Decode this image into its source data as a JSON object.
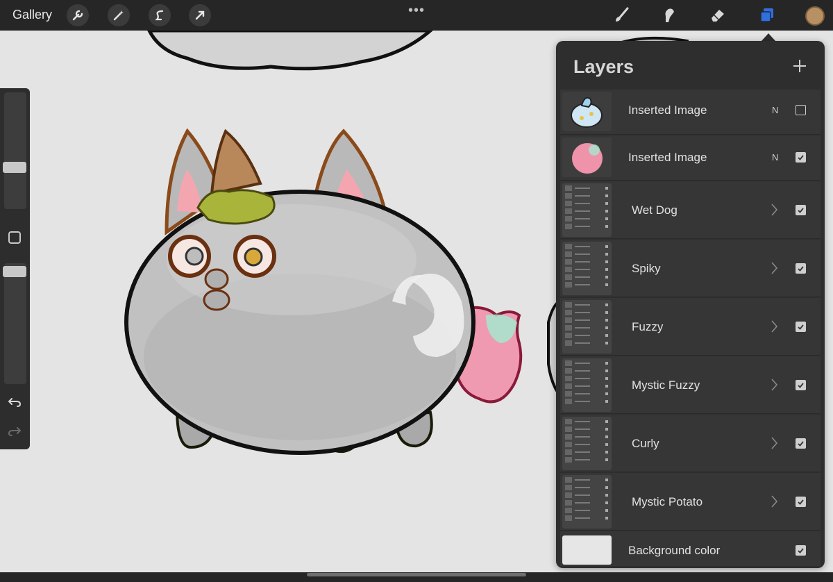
{
  "app": {
    "gallery_label": "Gallery",
    "more_menu": "•••"
  },
  "toolbar": {
    "left_tools": [
      "wrench-icon",
      "magic-wand-icon",
      "selection-icon",
      "transform-arrow-icon"
    ],
    "right_tools": [
      "brush-icon",
      "smudge-icon",
      "eraser-icon",
      "layers-icon"
    ],
    "active_color": "#b79064",
    "layers_accent": "#2f6fe0"
  },
  "sidebar": {
    "brush_size_label": "brush-size-slider",
    "opacity_label": "opacity-slider",
    "undo_icon": "undo-icon",
    "redo_icon": "redo-icon"
  },
  "layers": {
    "title": "Layers",
    "add_icon": "plus-icon",
    "items": [
      {
        "name": "Inserted Image",
        "blend": "N",
        "visible": false,
        "kind": "image"
      },
      {
        "name": "Inserted Image",
        "blend": "N",
        "visible": true,
        "kind": "image"
      },
      {
        "name": "Wet Dog",
        "blend": "",
        "visible": true,
        "kind": "group"
      },
      {
        "name": "Spiky",
        "blend": "",
        "visible": true,
        "kind": "group"
      },
      {
        "name": "Fuzzy",
        "blend": "",
        "visible": true,
        "kind": "group"
      },
      {
        "name": "Mystic Fuzzy",
        "blend": "",
        "visible": true,
        "kind": "group"
      },
      {
        "name": "Curly",
        "blend": "",
        "visible": true,
        "kind": "group"
      },
      {
        "name": "Mystic Potato",
        "blend": "",
        "visible": true,
        "kind": "group"
      },
      {
        "name": "Background color",
        "blend": "",
        "visible": true,
        "kind": "background"
      }
    ]
  }
}
